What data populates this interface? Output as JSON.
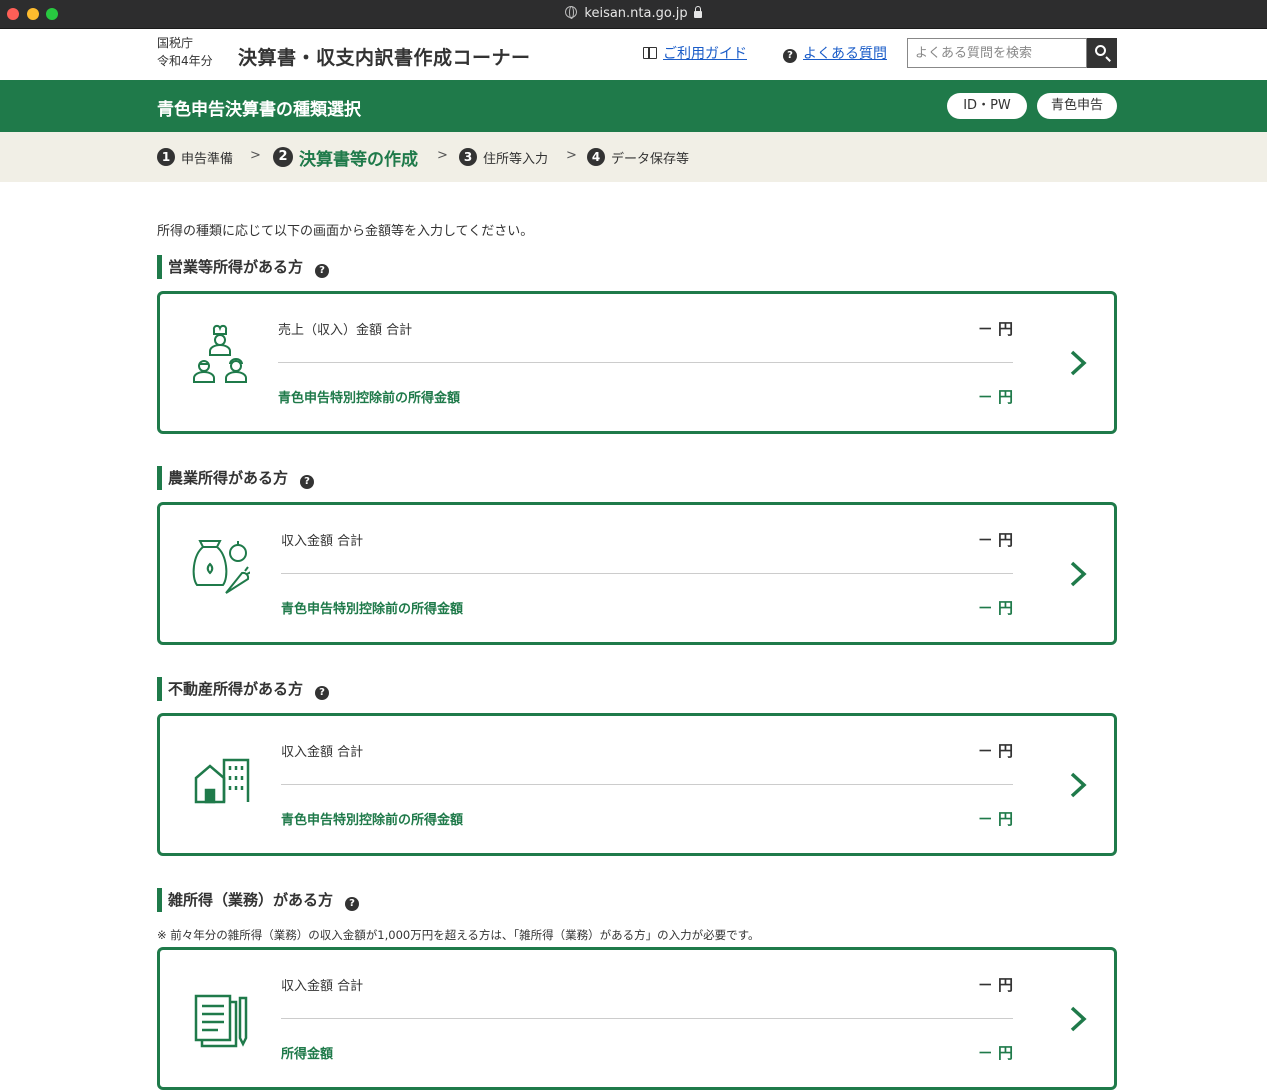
{
  "browser": {
    "url": "keisan.nta.go.jp"
  },
  "header": {
    "agency_line1": "国税庁",
    "agency_line2": "令和4年分",
    "site_title": "決算書・収支内訳書作成コーナー",
    "guide_label": "ご利用ガイド",
    "faq_label": "よくある質問",
    "search_placeholder": "よくある質問を検索"
  },
  "band": {
    "title": "青色申告決算書の種類選択",
    "pill_id": "ID・PW",
    "pill_blue": "青色申告"
  },
  "steps": [
    {
      "num": "1",
      "label": "申告準備"
    },
    {
      "num": "2",
      "label": "決算書等の作成"
    },
    {
      "num": "3",
      "label": "住所等入力"
    },
    {
      "num": "4",
      "label": "データ保存等"
    }
  ],
  "intro": "所得の種類に応じて以下の画面から金額等を入力してください。",
  "sections": [
    {
      "title": "営業等所得がある方",
      "icon": "business-people-icon",
      "row1_label": "売上（収入）金額  合計",
      "row1_value": "－ 円",
      "row2_label": "青色申告特別控除前の所得金額",
      "row2_value": "－ 円"
    },
    {
      "title": "農業所得がある方",
      "icon": "agriculture-icon",
      "row1_label": "収入金額  合計",
      "row1_value": "－ 円",
      "row2_label": "青色申告特別控除前の所得金額",
      "row2_value": "－ 円"
    },
    {
      "title": "不動産所得がある方",
      "icon": "real-estate-icon",
      "row1_label": "収入金額  合計",
      "row1_value": "－ 円",
      "row2_label": "青色申告特別控除前の所得金額",
      "row2_value": "－ 円"
    },
    {
      "title": "雑所得（業務）がある方",
      "icon": "documents-icon",
      "note": "※ 前々年分の雑所得（業務）の収入金額が1,000万円を超える方は、「雑所得（業務）がある方」の入力が必要です。",
      "row1_label": "収入金額  合計",
      "row1_value": "－ 円",
      "row2_label": "所得金額",
      "row2_value": "－ 円"
    }
  ],
  "colors": {
    "brand_green": "#1f7a4a",
    "step_bg": "#f1efe6",
    "link_blue": "#1a5cc8"
  }
}
